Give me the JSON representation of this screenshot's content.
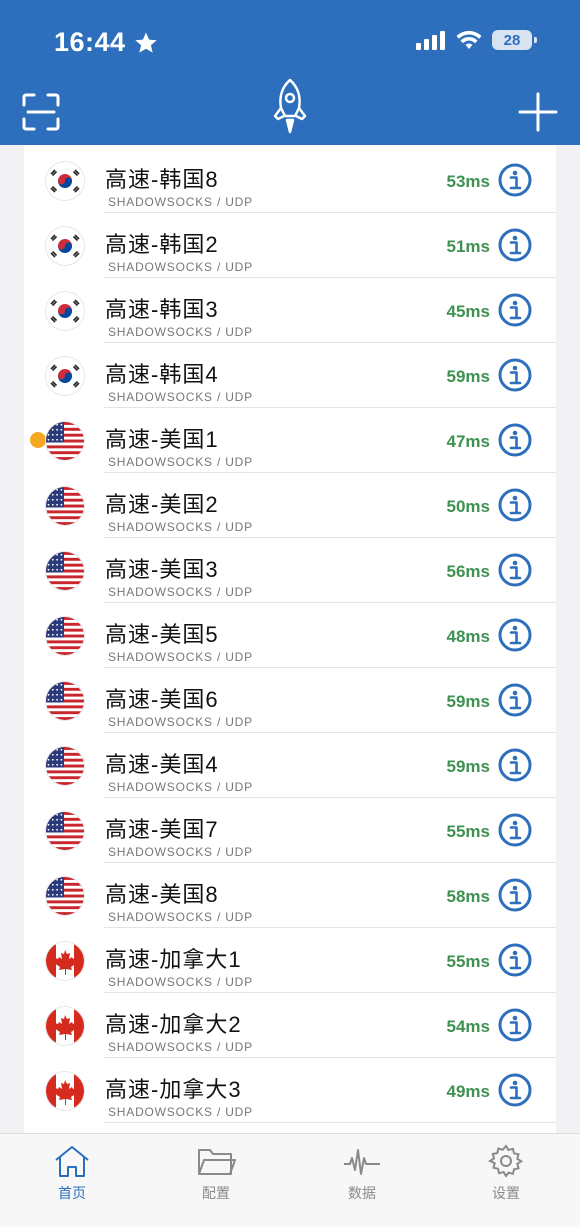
{
  "status_bar": {
    "time": "16:44",
    "battery": "28"
  },
  "colors": {
    "header": "#2d6fbd",
    "latency": "#3f9152",
    "active_dot": "#f5a623"
  },
  "header": {
    "left_icon": "scan-icon",
    "center_icon": "rocket-icon",
    "right_icon": "plus-icon"
  },
  "servers": [
    {
      "name": "高速-韩国8",
      "protocol": "SHADOWSOCKS / UDP",
      "latency": "53ms",
      "flag": "kr",
      "active": false
    },
    {
      "name": "高速-韩国2",
      "protocol": "SHADOWSOCKS / UDP",
      "latency": "51ms",
      "flag": "kr",
      "active": false
    },
    {
      "name": "高速-韩国3",
      "protocol": "SHADOWSOCKS / UDP",
      "latency": "45ms",
      "flag": "kr",
      "active": false
    },
    {
      "name": "高速-韩国4",
      "protocol": "SHADOWSOCKS / UDP",
      "latency": "59ms",
      "flag": "kr",
      "active": false
    },
    {
      "name": "高速-美国1",
      "protocol": "SHADOWSOCKS / UDP",
      "latency": "47ms",
      "flag": "us",
      "active": true
    },
    {
      "name": "高速-美国2",
      "protocol": "SHADOWSOCKS / UDP",
      "latency": "50ms",
      "flag": "us",
      "active": false
    },
    {
      "name": "高速-美国3",
      "protocol": "SHADOWSOCKS / UDP",
      "latency": "56ms",
      "flag": "us",
      "active": false
    },
    {
      "name": "高速-美国5",
      "protocol": "SHADOWSOCKS / UDP",
      "latency": "48ms",
      "flag": "us",
      "active": false
    },
    {
      "name": "高速-美国6",
      "protocol": "SHADOWSOCKS / UDP",
      "latency": "59ms",
      "flag": "us",
      "active": false
    },
    {
      "name": "高速-美国4",
      "protocol": "SHADOWSOCKS / UDP",
      "latency": "59ms",
      "flag": "us",
      "active": false
    },
    {
      "name": "高速-美国7",
      "protocol": "SHADOWSOCKS / UDP",
      "latency": "55ms",
      "flag": "us",
      "active": false
    },
    {
      "name": "高速-美国8",
      "protocol": "SHADOWSOCKS / UDP",
      "latency": "58ms",
      "flag": "us",
      "active": false
    },
    {
      "name": "高速-加拿大1",
      "protocol": "SHADOWSOCKS / UDP",
      "latency": "55ms",
      "flag": "ca",
      "active": false
    },
    {
      "name": "高速-加拿大2",
      "protocol": "SHADOWSOCKS / UDP",
      "latency": "54ms",
      "flag": "ca",
      "active": false
    },
    {
      "name": "高速-加拿大3",
      "protocol": "SHADOWSOCKS / UDP",
      "latency": "49ms",
      "flag": "ca",
      "active": false
    }
  ],
  "tabs": [
    {
      "label": "首页",
      "icon": "home-icon",
      "active": true
    },
    {
      "label": "配置",
      "icon": "folder-icon",
      "active": false
    },
    {
      "label": "数据",
      "icon": "activity-icon",
      "active": false
    },
    {
      "label": "设置",
      "icon": "gear-icon",
      "active": false
    }
  ]
}
